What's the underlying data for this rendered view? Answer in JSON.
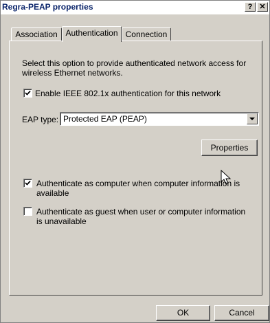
{
  "window": {
    "title": "Regra-PEAP properties",
    "help_label": "?",
    "close_label": "✕"
  },
  "tabs": [
    {
      "label": "Association",
      "active": false
    },
    {
      "label": "Authentication",
      "active": true
    },
    {
      "label": "Connection",
      "active": false
    }
  ],
  "auth": {
    "description": "Select this option to provide authenticated network access for wireless Ethernet networks.",
    "enable_8021x": {
      "label": "Enable IEEE 802.1x authentication for this network",
      "checked": true
    },
    "eap_type_label": "EAP type:",
    "eap_type_value": "Protected EAP (PEAP)",
    "properties_label": "Properties",
    "auth_as_computer": {
      "label": "Authenticate as computer when computer information is available",
      "checked": true
    },
    "auth_as_guest": {
      "label": "Authenticate as guest when user or computer information is unavailable",
      "checked": false
    }
  },
  "footer": {
    "ok_label": "OK",
    "cancel_label": "Cancel"
  },
  "colors": {
    "dialog_bg": "#d4d0c8",
    "title_text": "#0a246a"
  },
  "icons": {
    "dropdown": "chevron-down-icon",
    "check": "checkmark-icon",
    "cursor": "mouse-pointer-icon"
  }
}
